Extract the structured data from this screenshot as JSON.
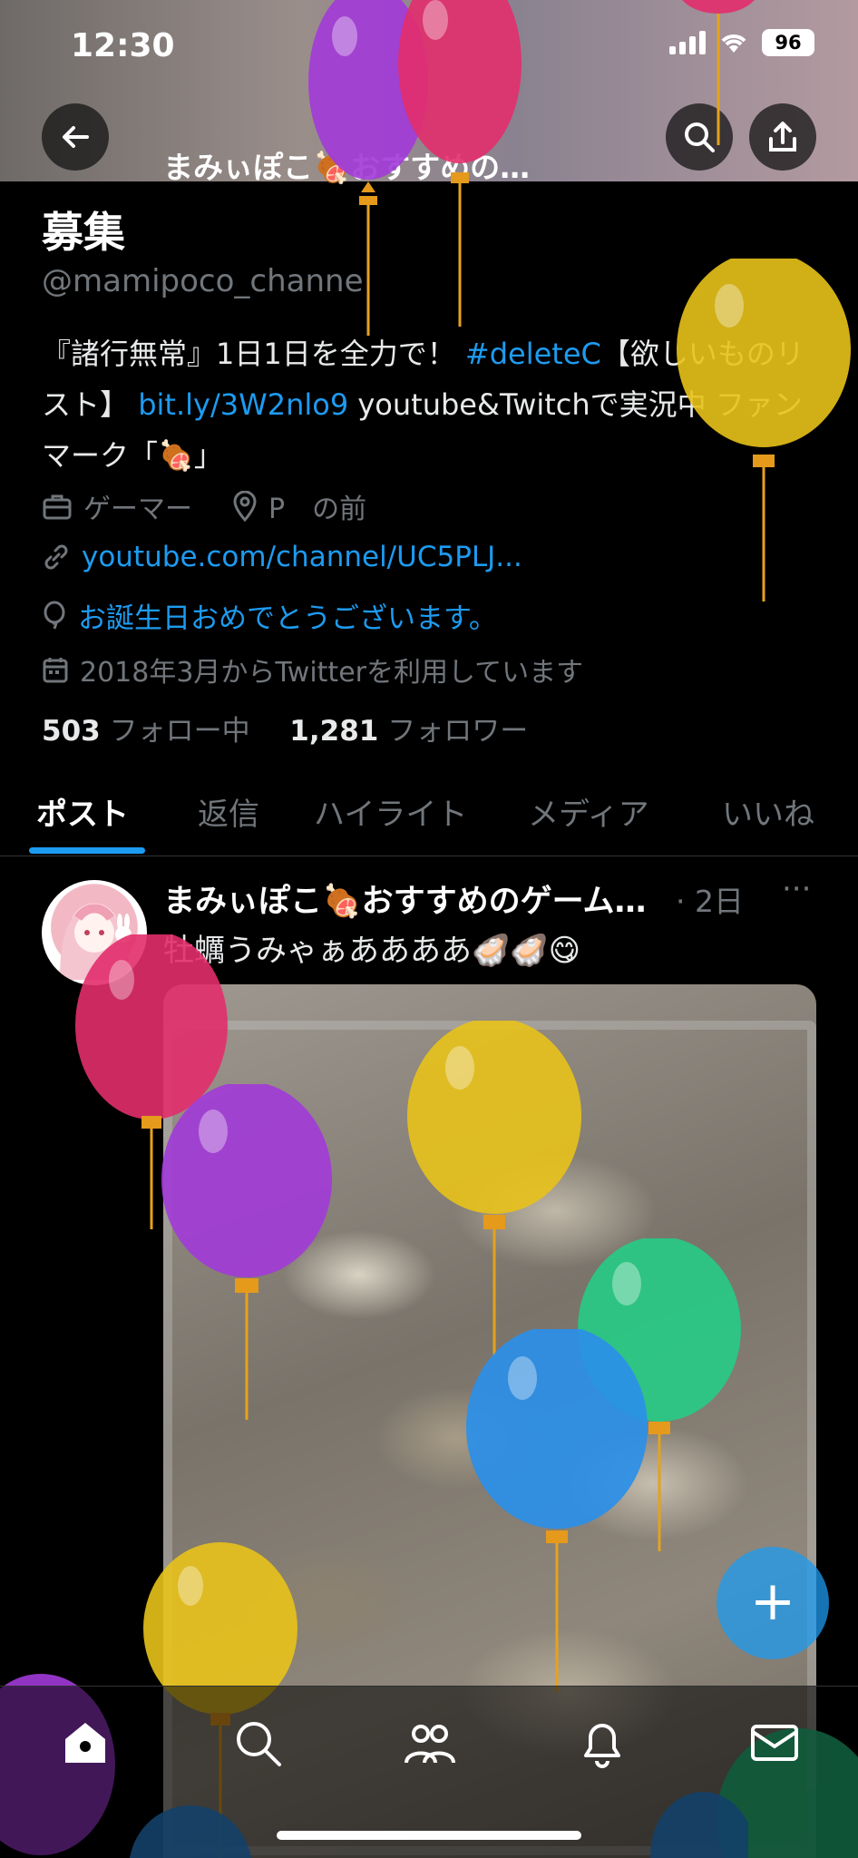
{
  "status_bar": {
    "time": "12:30",
    "battery": "96"
  },
  "header": {
    "title": "まみぃぽこ🍖おすすめの…"
  },
  "profile": {
    "name_visible": "募集",
    "handle": "@mamipoco_channe",
    "bio_text_1": "『諸行無常』1日1日を全力で！",
    "bio_hashtag": "#deleteC",
    "bio_text_2": "【欲しいものリスト】",
    "bio_link": "bit.ly/3W2nlo9",
    "bio_text_3": " youtube&Twitchで実況中 ファンマーク「🍖」",
    "profession": "ゲーマー",
    "location": "P　の前",
    "website": "youtube.com/channel/UC5PLJ...",
    "birthday": "お誕生日おめでとうございます。",
    "joined": "2018年3月からTwitterを利用しています",
    "following_count": "503",
    "following_label": "フォロー中",
    "followers_count": "1,281",
    "followers_label": "フォロワー"
  },
  "tabs": [
    "ポスト",
    "返信",
    "ハイライト",
    "メディア",
    "いいね"
  ],
  "active_tab": "ポスト",
  "post": {
    "author": "まみぃぽこ🍖おすすめのゲーム…",
    "time": "· 2日",
    "more": "···",
    "text": "牡蠣うみゃぁああああ🦪🦪😋"
  },
  "fab_label": "+",
  "icons": [
    "back-arrow-icon",
    "search-icon",
    "share-icon",
    "briefcase-icon",
    "location-pin-icon",
    "link-icon",
    "balloon-icon",
    "calendar-icon",
    "home-icon",
    "explore-icon",
    "communities-icon",
    "notifications-icon",
    "messages-icon"
  ],
  "colors": {
    "accent": "#1d9bf0",
    "background": "#000000",
    "muted": "#71767b"
  }
}
